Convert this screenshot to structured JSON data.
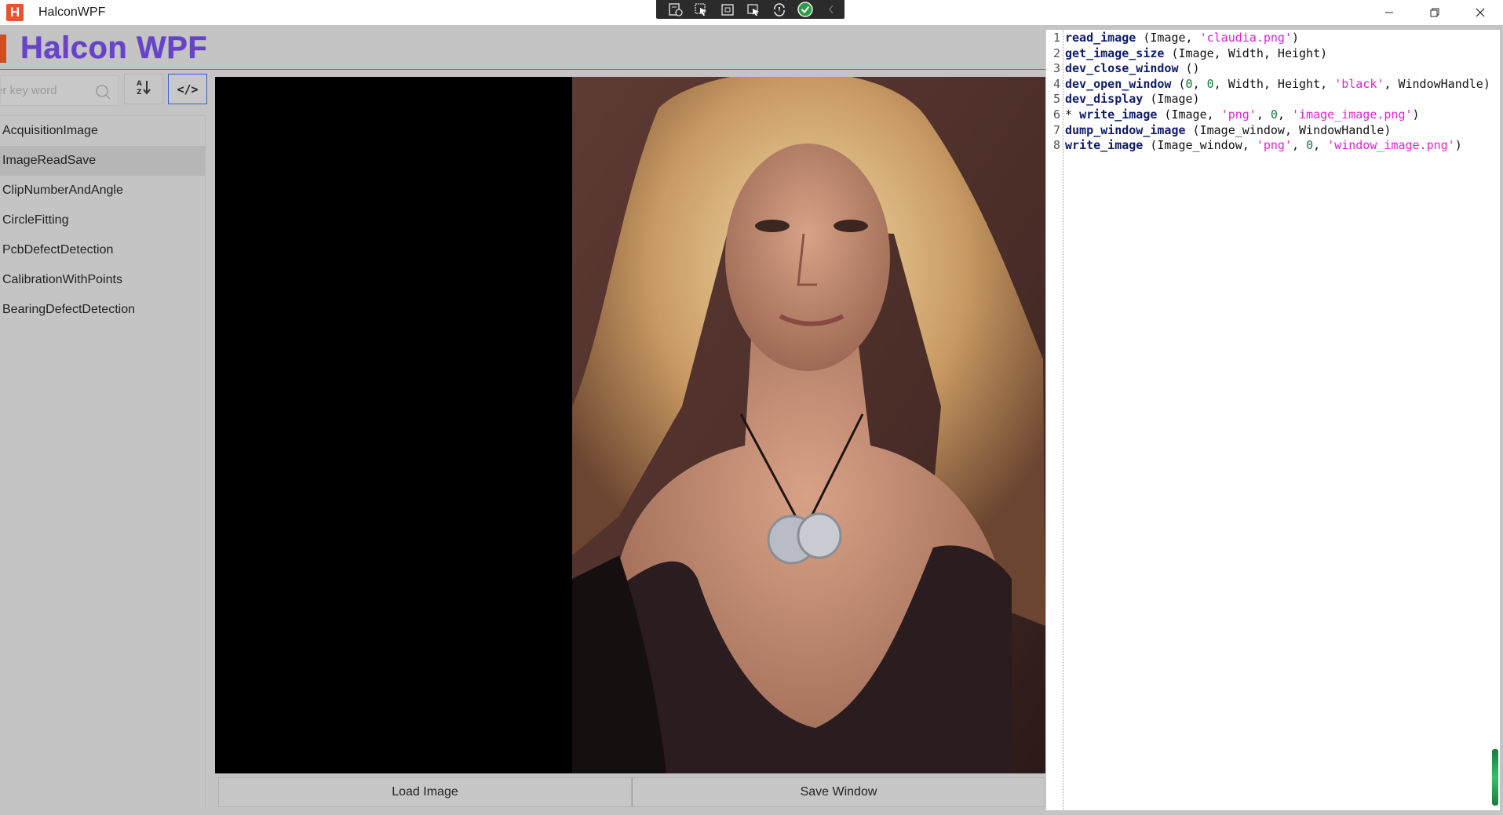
{
  "window": {
    "title": "HalconWPF",
    "icon_letter": "H"
  },
  "header": {
    "brand": "Halcon WPF"
  },
  "sidebar": {
    "search_placeholder": "er key word",
    "items": [
      {
        "label": "AcquisitionImage"
      },
      {
        "label": "ImageReadSave"
      },
      {
        "label": "ClipNumberAndAngle"
      },
      {
        "label": "CircleFitting"
      },
      {
        "label": "PcbDefectDetection"
      },
      {
        "label": "CalibrationWithPoints"
      },
      {
        "label": "BearingDefectDetection"
      }
    ],
    "selected_item": "ImageReadSave"
  },
  "toolbar": {
    "code_toggle_label": "</>"
  },
  "actions": {
    "load_label": "Load Image",
    "save_label": "Save Window"
  },
  "editor": {
    "lines": [
      {
        "n": "1",
        "tokens": [
          [
            "kw",
            "read_image"
          ],
          [
            "p",
            " (Image, "
          ],
          [
            "str",
            "'claudia.png'"
          ],
          [
            "p",
            ")"
          ]
        ]
      },
      {
        "n": "2",
        "tokens": [
          [
            "kw",
            "get_image_size"
          ],
          [
            "p",
            " (Image, Width, Height)"
          ]
        ]
      },
      {
        "n": "3",
        "tokens": [
          [
            "kw",
            "dev_close_window"
          ],
          [
            "p",
            " ()"
          ]
        ]
      },
      {
        "n": "4",
        "tokens": [
          [
            "kw",
            "dev_open_window"
          ],
          [
            "p",
            " ("
          ],
          [
            "num",
            "0"
          ],
          [
            "p",
            ", "
          ],
          [
            "num",
            "0"
          ],
          [
            "p",
            ", Width, Height, "
          ],
          [
            "str",
            "'black'"
          ],
          [
            "p",
            ", WindowHandle)"
          ]
        ]
      },
      {
        "n": "5",
        "tokens": [
          [
            "kw",
            "dev_display"
          ],
          [
            "p",
            " (Image)"
          ]
        ]
      },
      {
        "n": "6",
        "tokens": [
          [
            "cm",
            "* "
          ],
          [
            "kw",
            "write_image"
          ],
          [
            "p",
            " (Image, "
          ],
          [
            "str",
            "'png'"
          ],
          [
            "p",
            ", "
          ],
          [
            "num",
            "0"
          ],
          [
            "p",
            ", "
          ],
          [
            "str",
            "'image_image.png'"
          ],
          [
            "p",
            ")"
          ]
        ]
      },
      {
        "n": "7",
        "tokens": [
          [
            "kw",
            "dump_window_image"
          ],
          [
            "p",
            " (Image_window, WindowHandle)"
          ]
        ]
      },
      {
        "n": "8",
        "tokens": [
          [
            "kw",
            "write_image"
          ],
          [
            "p",
            " (Image_window, "
          ],
          [
            "str",
            "'png'"
          ],
          [
            "p",
            ", "
          ],
          [
            "num",
            "0"
          ],
          [
            "p",
            ", "
          ],
          [
            "str",
            "'window_image.png'"
          ],
          [
            "p",
            ")"
          ]
        ]
      }
    ]
  },
  "colors": {
    "brand": "#6a42c8",
    "accent": "#3b5cc4",
    "keyword": "#0f1b6e",
    "string": "#e61edc",
    "number": "#117a3a"
  }
}
